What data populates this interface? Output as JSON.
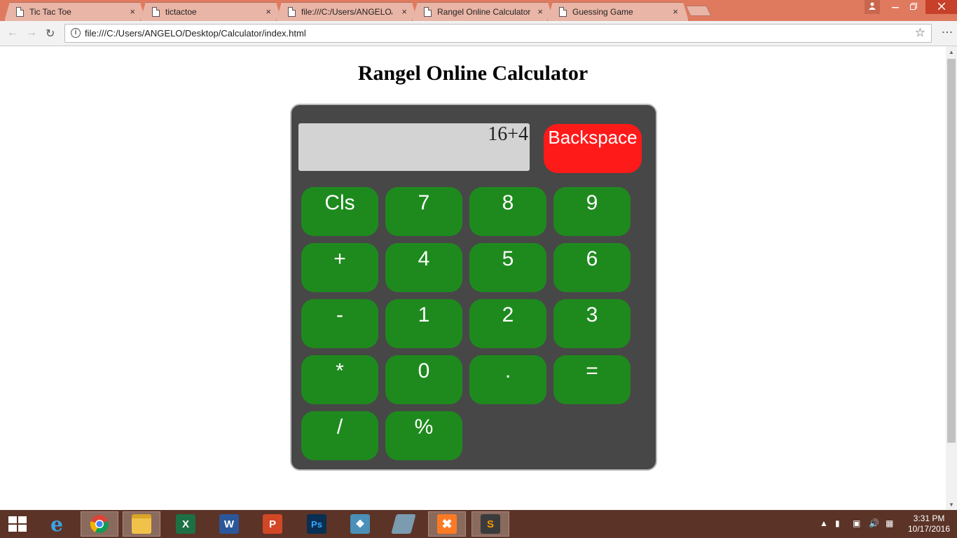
{
  "browser": {
    "tabs": [
      {
        "title": "Tic Tac Toe",
        "active": false
      },
      {
        "title": "tictactoe",
        "active": false
      },
      {
        "title": "file:///C:/Users/ANGELO/",
        "active": false
      },
      {
        "title": "Rangel Online Calculator",
        "active": true
      },
      {
        "title": "Guessing Game",
        "active": false
      }
    ],
    "close_glyph": "×",
    "url": "file:///C:/Users/ANGELO/Desktop/Calculator/index.html"
  },
  "page": {
    "title": "Rangel Online Calculator"
  },
  "calculator": {
    "display": "16+4",
    "backspace_label": "Backspace",
    "keys": [
      [
        "Cls",
        "7",
        "8",
        "9"
      ],
      [
        "+",
        "4",
        "5",
        "6"
      ],
      [
        "-",
        "1",
        "2",
        "3"
      ],
      [
        "*",
        "0",
        ".",
        "="
      ],
      [
        "/",
        "%"
      ]
    ],
    "colors": {
      "body": "#474747",
      "display": "#d3d3d3",
      "key": "#1e8a1e",
      "backspace": "#ff1a1a"
    }
  },
  "taskbar": {
    "apps": [
      "start-icon",
      "internet-explorer-icon",
      "chrome-icon",
      "file-explorer-icon",
      "excel-icon",
      "word-icon",
      "powerpoint-icon",
      "photoshop-icon",
      "mysql-workbench-icon",
      "unknown-app-icon",
      "xampp-icon",
      "sublime-text-icon"
    ],
    "time": "3:31 PM",
    "date": "10/17/2016"
  }
}
